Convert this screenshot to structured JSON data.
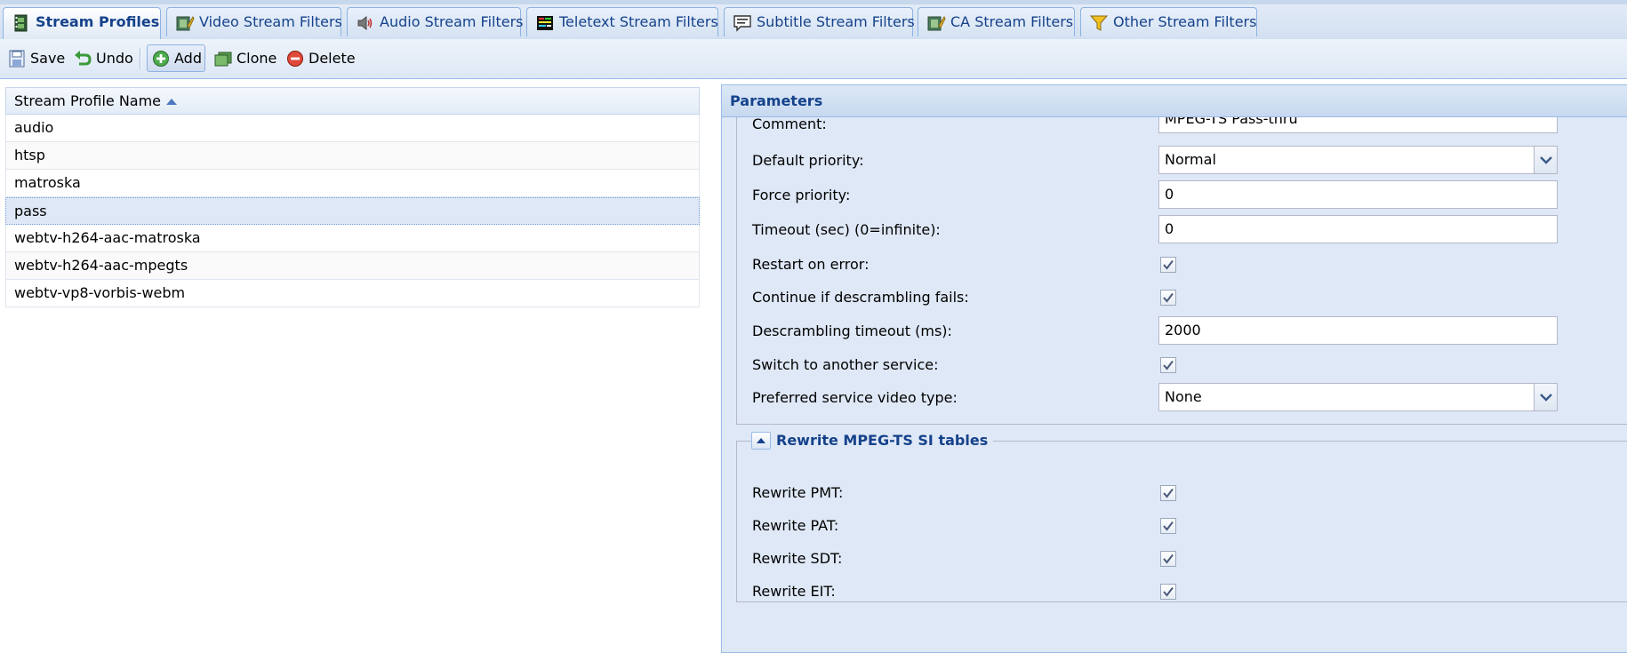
{
  "tabs": [
    {
      "label": "Stream Profiles",
      "icon": "film-profile-icon",
      "active": true
    },
    {
      "label": "Video Stream Filters",
      "icon": "video-filter-icon",
      "active": false
    },
    {
      "label": "Audio Stream Filters",
      "icon": "speaker-icon",
      "active": false
    },
    {
      "label": "Teletext Stream Filters",
      "icon": "teletext-icon",
      "active": false
    },
    {
      "label": "Subtitle Stream Filters",
      "icon": "subtitle-icon",
      "active": false
    },
    {
      "label": "CA Stream Filters",
      "icon": "ca-filter-icon",
      "active": false
    },
    {
      "label": "Other Stream Filters",
      "icon": "funnel-icon",
      "active": false
    }
  ],
  "toolbar": {
    "save": "Save",
    "undo": "Undo",
    "add": "Add",
    "clone": "Clone",
    "delete": "Delete"
  },
  "grid": {
    "column_header": "Stream Profile Name",
    "rows": [
      "audio",
      "htsp",
      "matroska",
      "pass",
      "webtv-h264-aac-matroska",
      "webtv-h264-aac-mpegts",
      "webtv-vp8-vorbis-webm"
    ],
    "selected_row": "pass"
  },
  "panel": {
    "title": "Parameters",
    "fields": {
      "comment_label": "Comment:",
      "comment_value": "MPEG-TS Pass-thru",
      "default_priority_label": "Default priority:",
      "default_priority_value": "Normal",
      "force_priority_label": "Force priority:",
      "force_priority_value": "0",
      "timeout_label": "Timeout (sec) (0=infinite):",
      "timeout_value": "0",
      "restart_label": "Restart on error:",
      "restart_checked": true,
      "continue_label": "Continue if descrambling fails:",
      "continue_checked": true,
      "descr_timeout_label": "Descrambling timeout (ms):",
      "descr_timeout_value": "2000",
      "switch_label": "Switch to another service:",
      "switch_checked": true,
      "pref_video_label": "Preferred service video type:",
      "pref_video_value": "None"
    },
    "rewrite": {
      "legend": "Rewrite MPEG-TS SI tables",
      "pmt_label": "Rewrite PMT:",
      "pat_label": "Rewrite PAT:",
      "sdt_label": "Rewrite SDT:",
      "eit_label": "Rewrite EIT:",
      "pmt_checked": true,
      "pat_checked": true,
      "sdt_checked": true,
      "eit_checked": true
    }
  },
  "colors": {
    "accent_text": "#15428b",
    "panel_bg": "#dfe8f6",
    "border": "#99bbe8",
    "selected_row": "#dfe8f6"
  }
}
